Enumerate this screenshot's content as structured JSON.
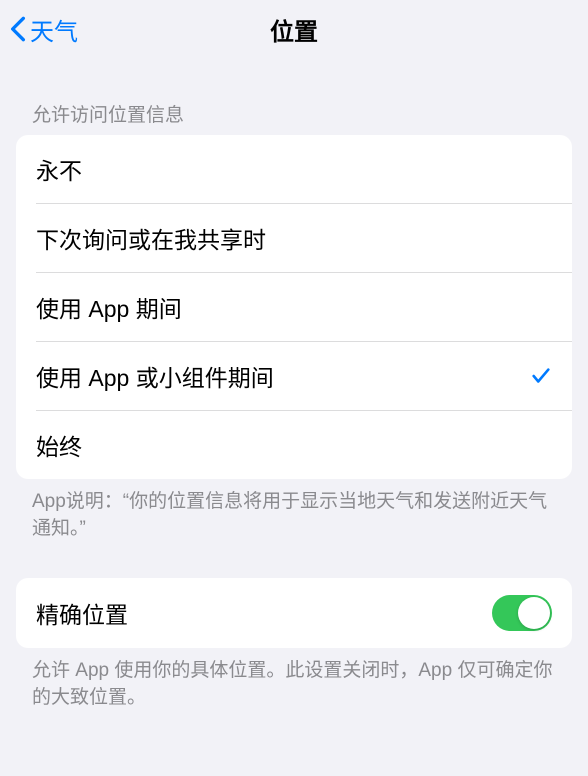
{
  "nav": {
    "back_label": "天气",
    "title": "位置"
  },
  "section1": {
    "header": "允许访问位置信息",
    "items": [
      {
        "label": "永不",
        "selected": false
      },
      {
        "label": "下次询问或在我共享时",
        "selected": false
      },
      {
        "label": "使用 App 期间",
        "selected": false
      },
      {
        "label": "使用 App 或小组件期间",
        "selected": true
      },
      {
        "label": "始终",
        "selected": false
      }
    ],
    "footer": "App说明：“你的位置信息将用于显示当地天气和发送附近天气通知。”"
  },
  "section2": {
    "item": {
      "label": "精确位置",
      "enabled": true
    },
    "footer": "允许 App 使用你的具体位置。此设置关闭时，App 仅可确定你的大致位置。"
  }
}
